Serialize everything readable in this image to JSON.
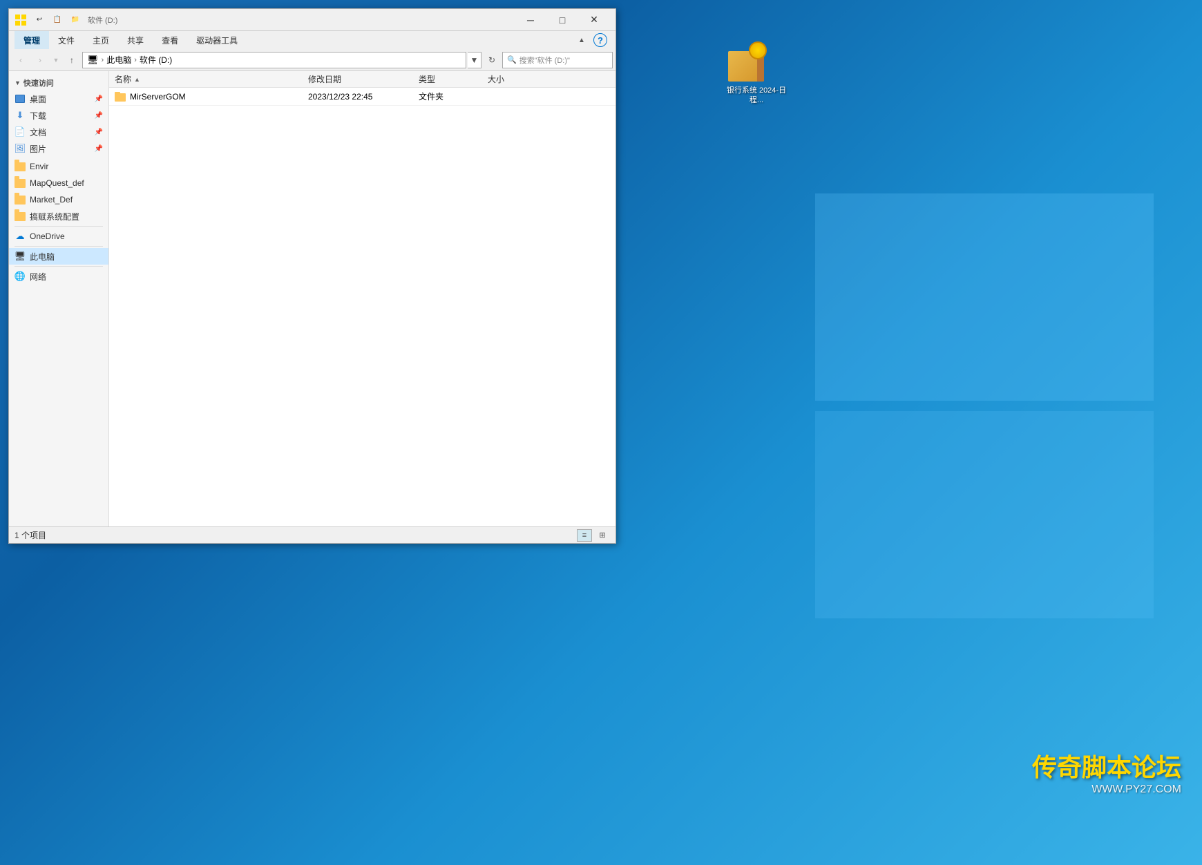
{
  "desktop": {
    "background": "#0078d4"
  },
  "window": {
    "title": "软件 (D:)",
    "manage_tab": "管理",
    "drive_label": "软件 (D:)",
    "tabs": [
      {
        "label": "文件",
        "active": false
      },
      {
        "label": "主页",
        "active": false
      },
      {
        "label": "共享",
        "active": false
      },
      {
        "label": "查看",
        "active": false
      },
      {
        "label": "驱动器工具",
        "active": false
      }
    ],
    "manage_label": "管理"
  },
  "qat": {
    "buttons": [
      "▼",
      "↩",
      "↩"
    ]
  },
  "titlebar": {
    "minimize": "─",
    "maximize": "□",
    "close": "✕"
  },
  "address": {
    "back_disabled": true,
    "forward_disabled": true,
    "up_label": "↑",
    "path_parts": [
      "此电脑",
      "软件 (D:)"
    ],
    "search_placeholder": "搜索\"软件 (D:)\""
  },
  "sidebar": {
    "sections": [
      {
        "header": "快速访问",
        "items": [
          {
            "label": "桌面",
            "icon": "desktop",
            "pinned": true
          },
          {
            "label": "下载",
            "icon": "download",
            "pinned": true
          },
          {
            "label": "文档",
            "icon": "doc",
            "pinned": true
          },
          {
            "label": "图片",
            "icon": "pic",
            "pinned": true
          }
        ]
      },
      {
        "header": null,
        "items": [
          {
            "label": "Envir",
            "icon": "folder"
          },
          {
            "label": "MapQuest_def",
            "icon": "folder"
          },
          {
            "label": "Market_Def",
            "icon": "folder"
          },
          {
            "label": "搞赋系统配置",
            "icon": "folder"
          }
        ]
      },
      {
        "header": null,
        "items": [
          {
            "label": "OneDrive",
            "icon": "cloud"
          }
        ]
      },
      {
        "header": null,
        "items": [
          {
            "label": "此电脑",
            "icon": "pc",
            "selected": true
          }
        ]
      },
      {
        "header": null,
        "items": [
          {
            "label": "网络",
            "icon": "network"
          }
        ]
      }
    ]
  },
  "file_list": {
    "columns": [
      {
        "key": "name",
        "label": "名称",
        "sort": "asc"
      },
      {
        "key": "date",
        "label": "修改日期"
      },
      {
        "key": "type",
        "label": "类型"
      },
      {
        "key": "size",
        "label": "大小"
      }
    ],
    "files": [
      {
        "name": "MirServerGOM",
        "date": "2023/12/23 22:45",
        "type": "文件夹",
        "size": ""
      }
    ]
  },
  "status_bar": {
    "count": "1 个项目"
  },
  "desktop_icon": {
    "label": "银行系统\n2024-日程..."
  },
  "watermark": {
    "main": "传奇脚本论坛",
    "url": "WWW.PY27.COM"
  }
}
